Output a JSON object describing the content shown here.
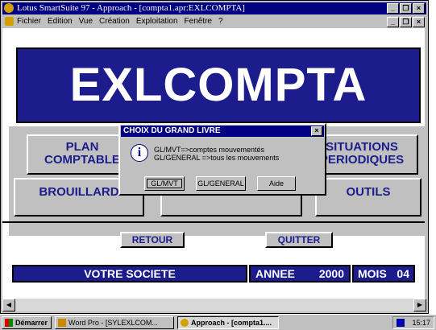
{
  "window": {
    "title": "Lotus SmartSuite 97  - Approach - [compta1.apr:EXLCOMPTA]",
    "controls": {
      "minimize": "_",
      "maximize": "❐",
      "close": "×"
    }
  },
  "menubar": {
    "items": [
      "Fichier",
      "Edition",
      "Vue",
      "Création",
      "Exploitation",
      "Fenêtre",
      "?"
    ]
  },
  "banner": {
    "title": "EXLCOMPTA"
  },
  "buttons": {
    "plan_comptable": "PLAN COMPTABLE",
    "situations": "SITUATIONS PERIODIQUES",
    "brouillard": "BROUILLARD",
    "outils": "OUTILS",
    "retour": "RETOUR",
    "quitter": "QUITTER"
  },
  "status": {
    "societe": "VOTRE SOCIETE",
    "annee_label": "ANNEE",
    "annee_value": "2000",
    "mois_label": "MOIS",
    "mois_value": "04"
  },
  "dialog": {
    "title": "CHOIX DU GRAND LIVRE",
    "line1": "GL/MVT=>comptes mouvementés",
    "line2": "GL/GENERAL  =>tous les mouvements",
    "buttons": [
      "GL/MVT",
      "GL/GENERAL",
      "Aide"
    ],
    "close": "×"
  },
  "taskbar": {
    "start": "Démarrer",
    "tasks": [
      "Word Pro - [SYLEXLCOM...",
      "Approach - [compta1...."
    ],
    "clock": "15:17"
  },
  "scroll": {
    "left": "◀",
    "right": "▶"
  },
  "colors": {
    "navy": "#1c1c8c",
    "titlebar": "#000080",
    "face": "#c0c0c0"
  },
  "icons": {
    "app": "lotus-approach-icon",
    "info": "information-icon",
    "start": "windows-flag-icon"
  }
}
